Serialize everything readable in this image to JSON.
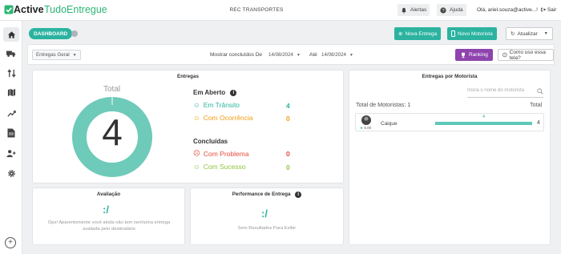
{
  "brand": {
    "name_bold": "Active",
    "name_rest": "TudoEntregue",
    "color": "#2bb673"
  },
  "topbar": {
    "company": "REC TRANSPORTES",
    "alerts_label": "Alertas",
    "help_label": "Ajuda",
    "user_greeting": "Olá, ariel.souza@active...!",
    "logout_label": "Sair"
  },
  "sidebar": {
    "items": [
      {
        "icon": "home-icon",
        "active": true
      },
      {
        "icon": "truck-icon",
        "active": false
      },
      {
        "icon": "swap-arrows-icon",
        "active": false
      },
      {
        "icon": "map-icon",
        "active": false
      },
      {
        "icon": "trend-chart-icon",
        "active": false
      },
      {
        "icon": "document-icon",
        "active": false
      },
      {
        "icon": "add-user-icon",
        "active": false
      },
      {
        "icon": "gear-icon",
        "active": false
      }
    ],
    "bottom_icon": "plus-circle-icon"
  },
  "header": {
    "dashboard_label": "DASHBOARD",
    "new_delivery_label": "Nova Entrega",
    "new_driver_label": "Novo Motorista",
    "refresh_label": "Atualizar"
  },
  "filters": {
    "type_selected": "Entregas Geral",
    "show_completed_label": "Mostrar concluídos De",
    "date_from": "14/08/2024",
    "until_label": "Até",
    "date_to": "14/08/2024",
    "ranking_label": "Ranking",
    "how_to_use_label": "Como uso essa tela?"
  },
  "deliveries": {
    "title": "Entregas",
    "total_label": "Total",
    "total_value": "4",
    "open_section": "Em Aberto",
    "in_transit_label": "Em Trânsito",
    "in_transit_value": "4",
    "occurrence_label": "Com Ocorrência",
    "occurrence_value": "0",
    "completed_section": "Concluídas",
    "problem_label": "Com Problema",
    "problem_value": "0",
    "success_label": "Com Sucesso",
    "success_value": "0"
  },
  "evaluation": {
    "title": "Avaliação",
    "icon_text": ":/",
    "message": "Ops! Aparentemente você ainda não tem nenhuma entrega avaliada pelo destinatário"
  },
  "performance": {
    "title": "Performance de Entrega",
    "icon_text": ":/",
    "message": "Sem Resultados Para Exibir"
  },
  "drivers": {
    "title": "Entregas por Motorista",
    "search_placeholder": "Insira o nome do motorista",
    "total_drivers_label": "Total de Motoristas: 1",
    "total_column_label": "Total",
    "rows": [
      {
        "name": "Caique",
        "rating": "5.00",
        "bar_label": "4",
        "total": "4",
        "bar_fraction": 1.0
      }
    ]
  },
  "colors": {
    "accent": "#2bb3a0",
    "ranking": "#8e44ad",
    "transit": "#2bb3a0",
    "occurrence": "#f39c12",
    "problem": "#e74c3c",
    "success": "#8cc63f"
  }
}
